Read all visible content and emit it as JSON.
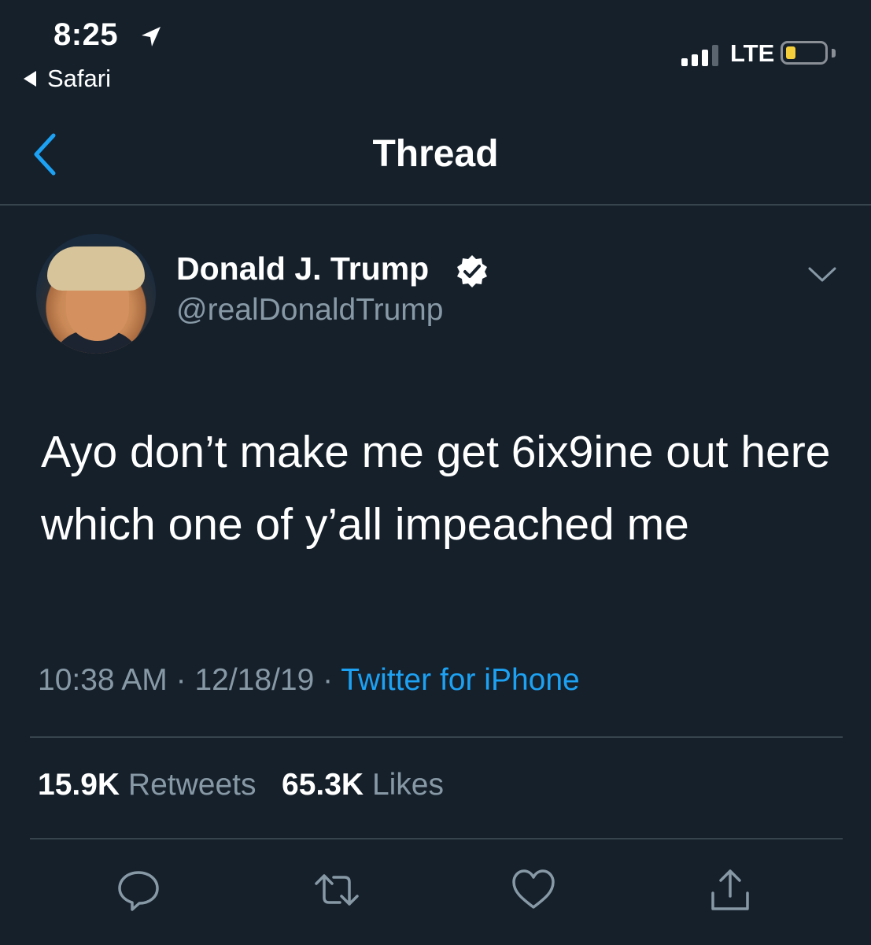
{
  "status_bar": {
    "time": "8:25",
    "back_app": "Safari",
    "network": "LTE",
    "icons": [
      "location-arrow-icon",
      "signal-bars-icon",
      "battery-low-icon"
    ],
    "battery_color": "#f5cf3b"
  },
  "nav": {
    "title": "Thread",
    "back_icon": "chevron-left-icon"
  },
  "tweet": {
    "display_name": "Donald J. Trump",
    "handle": "@realDonaldTrump",
    "verified_icon": "verified-badge-icon",
    "menu_icon": "chevron-down-icon",
    "text": "Ayo don’t make me get 6ix9ine out here which one of y’all impeached me",
    "time": "10:38 AM",
    "date": "12/18/19",
    "separator": "·",
    "source": "Twitter for iPhone",
    "retweets_count": "15.9K",
    "retweets_label": "Retweets",
    "likes_count": "65.3K",
    "likes_label": "Likes"
  },
  "actions": [
    "reply-icon",
    "retweet-icon",
    "like-icon",
    "share-icon"
  ],
  "colors": {
    "background": "#15202b",
    "accent": "#1da1f2",
    "secondary_text": "#8899a6",
    "divider": "#38444d"
  }
}
